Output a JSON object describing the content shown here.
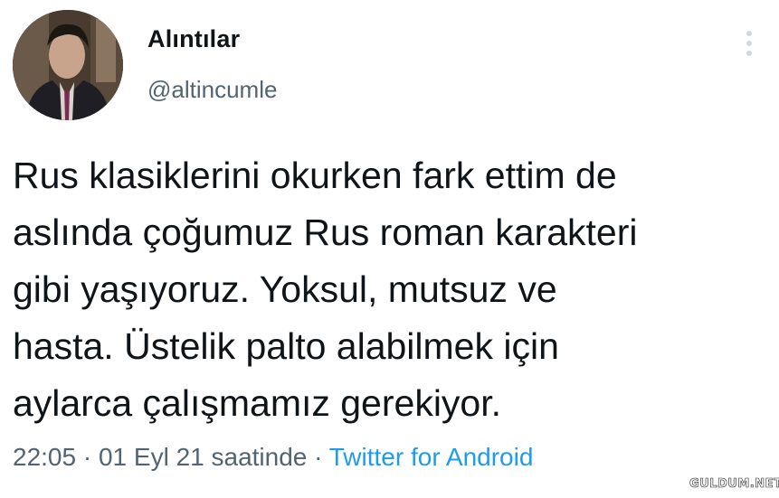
{
  "tweet": {
    "author": {
      "display_name": "Alıntılar",
      "handle": "@altincumle",
      "avatar": "profile-photo"
    },
    "text_lines": [
      "Rus klasiklerini okurken fark ettim de",
      "aslında çoğumuz Rus roman karakteri",
      "gibi yaşıyoruz. Yoksul, mutsuz ve",
      "hasta. Üstelik palto alabilmek için",
      "aylarca çalışmamız gerekiyor."
    ],
    "time": "22:05",
    "separator": "·",
    "date": "01 Eyl 21 saatinde",
    "source": "Twitter for Android",
    "more_icon": "vertical-ellipsis-icon"
  },
  "watermark": "GULDUM.NET",
  "colors": {
    "text_primary": "#0f1419",
    "text_secondary": "#536471",
    "link": "#1d9bf0",
    "more_icon": "#cfd9de"
  }
}
